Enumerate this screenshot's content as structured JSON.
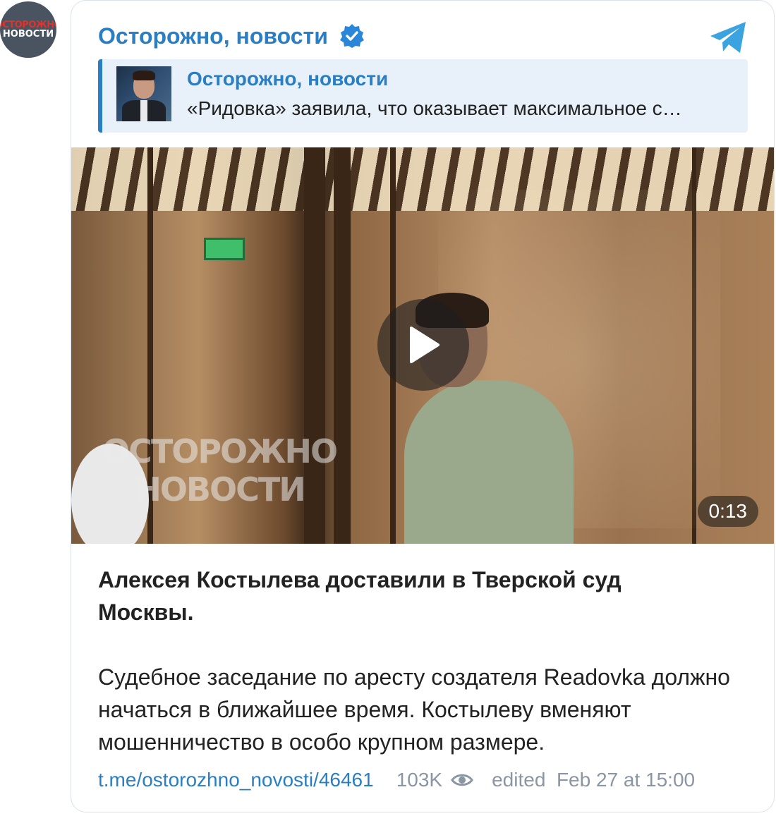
{
  "avatar": {
    "line1": "ОСТОРОЖНО",
    "line2": "НОВОСТИ"
  },
  "channel": {
    "name": "Осторожно, новости"
  },
  "icons": {
    "verified": "verified-check-icon",
    "telegram": "telegram-icon",
    "play": "play-icon",
    "views": "eye-icon"
  },
  "reply": {
    "title": "Осторожно, новости",
    "text": "«Ридовка» заявила, что оказывает максимальное с…"
  },
  "video": {
    "watermark_line1": "ОСТОРОЖНО",
    "watermark_line2": "НОВОСТИ",
    "duration": "0:13"
  },
  "post": {
    "headline": "Алексея Костылева доставили в Тверской суд Москвы.",
    "body": "Судебное заседание по аресту создателя Readovka должно начаться в ближайшее время. Костылеву вменяют мошенничество в особо крупном размере."
  },
  "footer": {
    "link": "t.me/ostorozhno_novosti/46461",
    "views": "103K",
    "edited": "edited  Feb 27 at 15:00"
  },
  "colors": {
    "accent": "#2a7ec4",
    "reply_bg": "#e8f1fa",
    "muted": "#8a96a3"
  }
}
